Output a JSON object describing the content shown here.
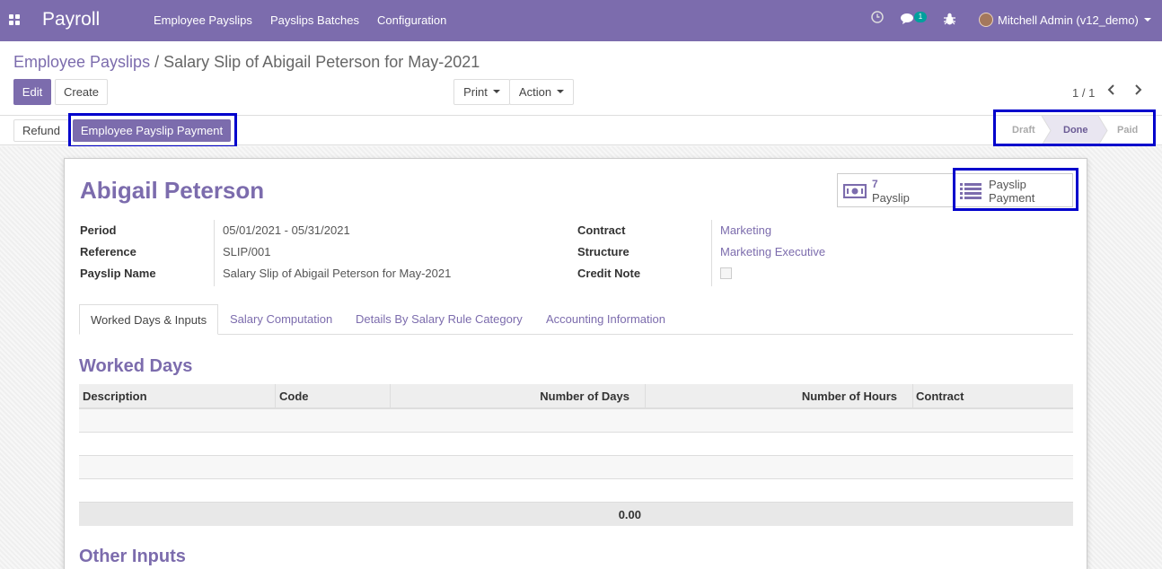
{
  "navbar": {
    "app_name": "Payroll",
    "menu": [
      "Employee Payslips",
      "Payslips Batches",
      "Configuration"
    ],
    "messages_count": "1",
    "user": "Mitchell Admin (v12_demo)"
  },
  "breadcrumb": {
    "parent": "Employee Payslips",
    "separator": "/",
    "current": "Salary Slip of Abigail Peterson for May-2021"
  },
  "toolbar": {
    "edit": "Edit",
    "create": "Create",
    "print": "Print",
    "action": "Action"
  },
  "pager": {
    "value": "1 / 1"
  },
  "header_buttons": {
    "refund": "Refund",
    "payment": "Employee Payslip Payment"
  },
  "statusbar": {
    "stages": [
      "Draft",
      "Done",
      "Paid"
    ],
    "active": "Done"
  },
  "smart_buttons": {
    "payslip_count": "7",
    "payslip_label": "Payslip",
    "payment_line1": "Payslip",
    "payment_line2": "Payment"
  },
  "employee_name": "Abigail Peterson",
  "fields_left": [
    {
      "label": "Period",
      "value": "05/01/2021 - 05/31/2021"
    },
    {
      "label": "Reference",
      "value": "SLIP/001"
    },
    {
      "label": "Payslip Name",
      "value": "Salary Slip of Abigail Peterson for May-2021"
    }
  ],
  "fields_right": [
    {
      "label": "Contract",
      "value": "Marketing"
    },
    {
      "label": "Structure",
      "value": "Marketing Executive"
    },
    {
      "label": "Credit Note",
      "value": ""
    }
  ],
  "tabs": [
    "Worked Days & Inputs",
    "Salary Computation",
    "Details By Salary Rule Category",
    "Accounting Information"
  ],
  "worked_days": {
    "title": "Worked Days",
    "columns": [
      "Description",
      "Code",
      "Number of Days",
      "Number of Hours",
      "Contract"
    ],
    "total_days": "0.00"
  },
  "other_inputs": {
    "title": "Other Inputs"
  },
  "colors": {
    "brand": "#7c6cad",
    "highlight": "#0000cc"
  }
}
